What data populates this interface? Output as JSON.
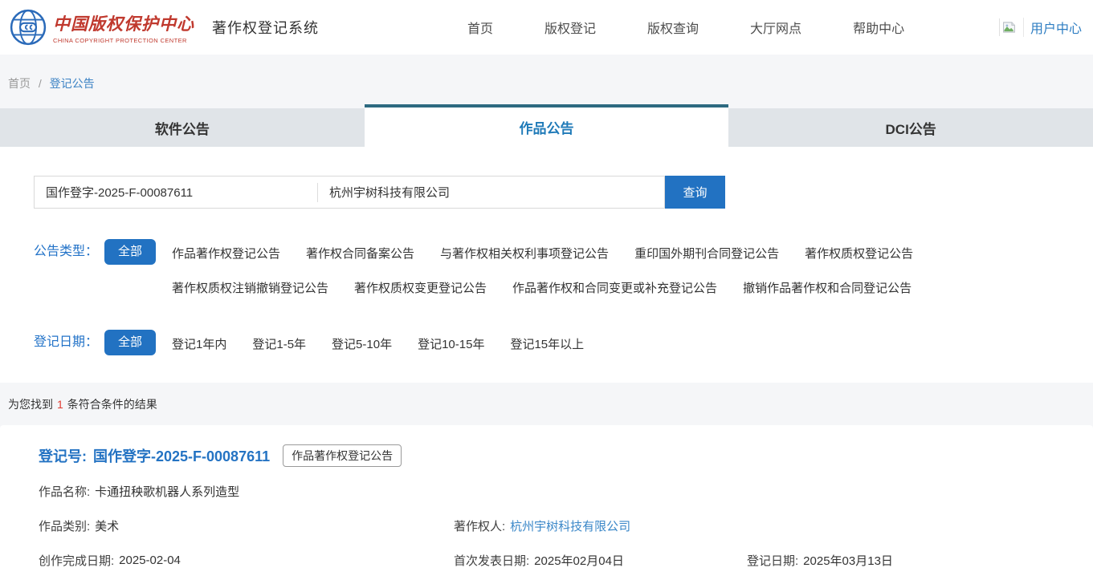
{
  "header": {
    "logo": {
      "title_cn": "中国版权保护中心",
      "title_en": "CHINA COPYRIGHT PROTECTION CENTER",
      "system_name": "著作权登记系统"
    },
    "nav": [
      {
        "label": "首页"
      },
      {
        "label": "版权登记"
      },
      {
        "label": "版权查询"
      },
      {
        "label": "大厅网点"
      },
      {
        "label": "帮助中心"
      }
    ],
    "user_center": "用户中心"
  },
  "breadcrumb": {
    "home": "首页",
    "separator": "/",
    "current": "登记公告"
  },
  "tabs": [
    {
      "label": "软件公告"
    },
    {
      "label": "作品公告"
    },
    {
      "label": "DCI公告"
    }
  ],
  "search": {
    "registration_no_value": "国作登字-2025-F-00087611",
    "owner_value": "杭州宇树科技有限公司",
    "button_label": "查询"
  },
  "filters": {
    "type": {
      "label": "公告类型：",
      "selected": "全部",
      "options": [
        "作品著作权登记公告",
        "著作权合同备案公告",
        "与著作权相关权利事项登记公告",
        "重印国外期刊合同登记公告",
        "著作权质权登记公告",
        "著作权质权注销撤销登记公告",
        "著作权质权变更登记公告",
        "作品著作权和合同变更或补充登记公告",
        "撤销作品著作权和合同登记公告"
      ]
    },
    "date": {
      "label": "登记日期：",
      "selected": "全部",
      "options": [
        "登记1年内",
        "登记1-5年",
        "登记5-10年",
        "登记10-15年",
        "登记15年以上"
      ]
    }
  },
  "results": {
    "summary_prefix": "为您找到",
    "count": "1",
    "summary_suffix": "条符合条件的结果"
  },
  "result_card": {
    "reg_no_label": "登记号:",
    "reg_no": "国作登字-2025-F-00087611",
    "badge": "作品著作权登记公告",
    "work_name_label": "作品名称:",
    "work_name": "卡通扭秧歌机器人系列造型",
    "work_type_label": "作品类别:",
    "work_type": "美术",
    "owner_label": "著作权人:",
    "owner": "杭州宇树科技有限公司",
    "creation_date_label": "创作完成日期:",
    "creation_date": "2025-02-04",
    "publish_date_label": "首次发表日期:",
    "publish_date": "2025年02月04日",
    "reg_date_label": "登记日期:",
    "reg_date": "2025年03月13日"
  },
  "colors": {
    "accent_blue": "#2272c2",
    "label_blue": "#2373c8",
    "link_blue": "#3a87c8",
    "tab_active_text": "#1f7ab8",
    "tab_active_border": "#2d6a80",
    "tab_inactive_bg": "#e0e4e8",
    "logo_red": "#c0392e",
    "logo_blue": "#2a6ab9",
    "count_red": "#e03a30",
    "page_bg": "#f5f6f8"
  }
}
